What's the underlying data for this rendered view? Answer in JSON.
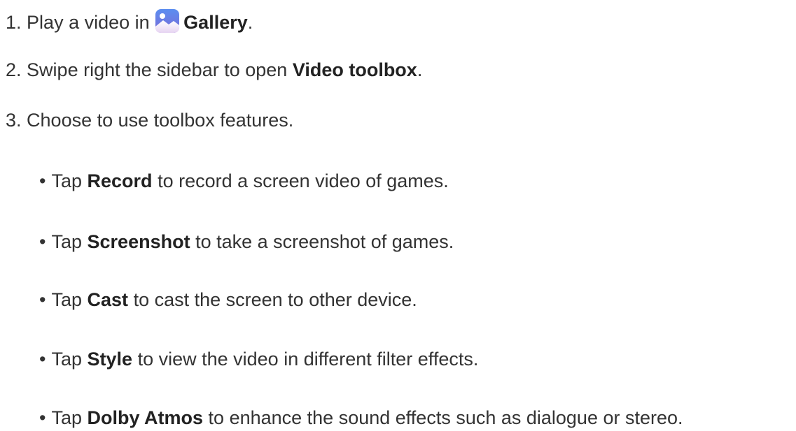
{
  "steps": [
    {
      "num": "1.",
      "pre": "Play a video in",
      "bold": "Gallery",
      "post": ".",
      "icon": "gallery-icon"
    },
    {
      "num": "2.",
      "pre": "Swipe right the sidebar to open",
      "bold": "Video toolbox",
      "post": "."
    },
    {
      "num": "3.",
      "text": "Choose to use toolbox features."
    }
  ],
  "bullet_char": "•",
  "features": [
    {
      "pre": "Tap",
      "bold": "Record",
      "post": "to record a screen video of games."
    },
    {
      "pre": "Tap",
      "bold": "Screenshot",
      "post": "to take a screenshot of games."
    },
    {
      "pre": "Tap",
      "bold": "Cast",
      "post": "to cast the screen to other device."
    },
    {
      "pre": "Tap",
      "bold": "Style",
      "post": "to view the video in different filter effects."
    },
    {
      "pre": "Tap",
      "bold": "Dolby Atmos",
      "post": "to enhance the sound effects such as dialogue or stereo."
    }
  ]
}
